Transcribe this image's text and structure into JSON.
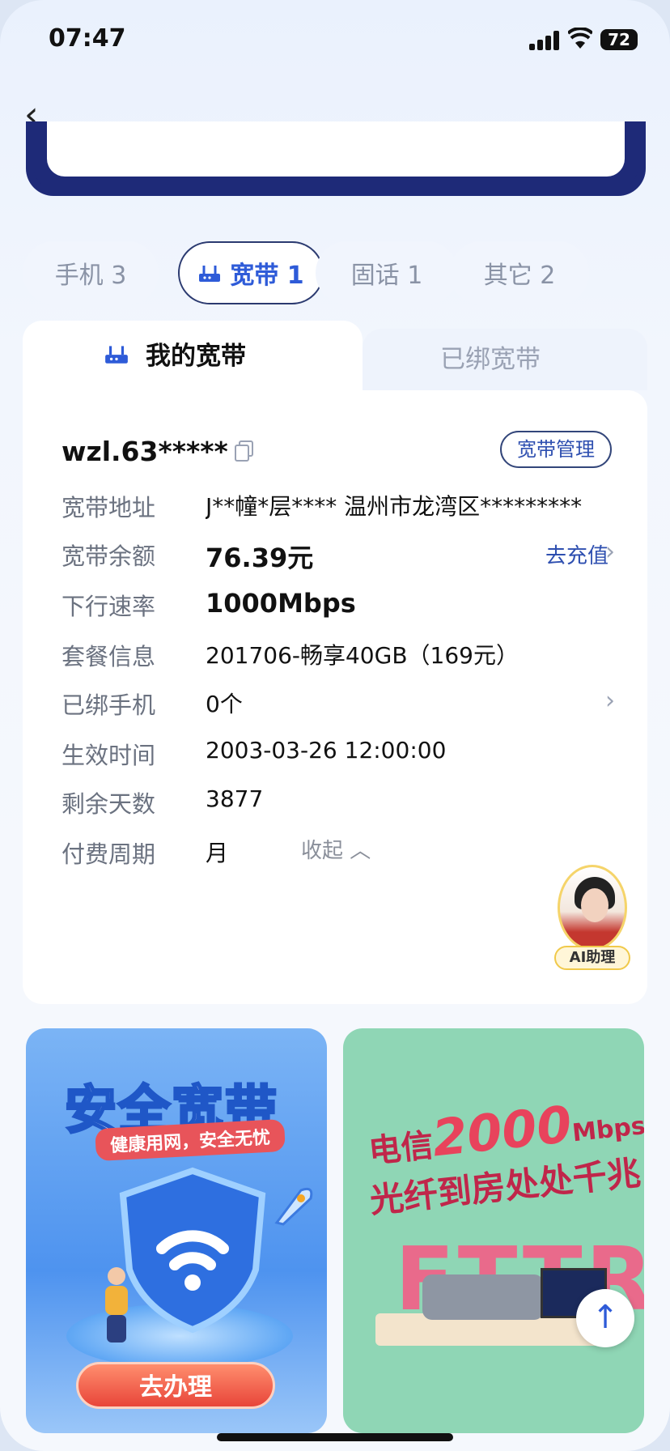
{
  "status": {
    "time": "07:47",
    "battery": "72"
  },
  "tabs": [
    {
      "label": "手机 3"
    },
    {
      "label": "宽带 1"
    },
    {
      "label": "固话 1"
    },
    {
      "label": "其它 2"
    }
  ],
  "subtabs": {
    "mine": "我的宽带",
    "bound": "已绑宽带"
  },
  "account": {
    "id": "wzl.63*****",
    "manage": "宽带管理"
  },
  "rows": [
    {
      "label": "宽带地址",
      "value": "J**幢*层****  温州市龙湾区*********"
    },
    {
      "label": "宽带余额",
      "value": "76.39元",
      "action": "去充值"
    },
    {
      "label": "下行速率",
      "value": "1000Mbps"
    },
    {
      "label": "套餐信息",
      "value": "201706-畅享40GB（169元）"
    },
    {
      "label": "已绑手机",
      "value": "0个"
    },
    {
      "label": "生效时间",
      "value": "2003-03-26 12:00:00"
    },
    {
      "label": "剩余天数",
      "value": "3877"
    },
    {
      "label": "付费周期",
      "value": "月"
    }
  ],
  "collapse": "收起 ︿",
  "ai_label": "AI助理",
  "banner1": {
    "title": "安全宽带",
    "subtitle": "健康用网，安全无忧",
    "button": "去办理"
  },
  "banner2": {
    "brand": "电信",
    "speed": "2000",
    "unit": "Mbps",
    "line2": "光纤到房处处千兆",
    "big": "FTTR"
  },
  "colors": {
    "accent": "#2e5bd8",
    "navy": "#1e2a78"
  }
}
